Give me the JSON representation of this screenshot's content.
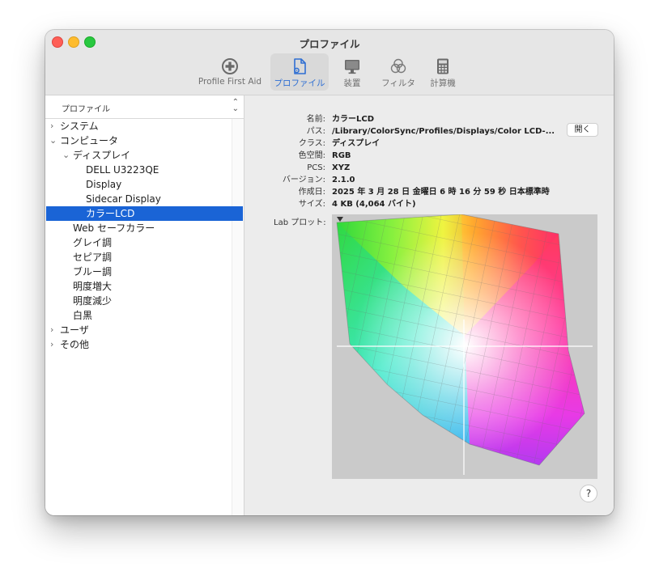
{
  "window": {
    "title": "プロファイル"
  },
  "toolbar": {
    "items": [
      {
        "label": "Profile First Aid",
        "icon": "first-aid-icon"
      },
      {
        "label": "プロファイル",
        "icon": "profile-document-icon",
        "active": true
      },
      {
        "label": "装置",
        "icon": "display-icon"
      },
      {
        "label": "フィルタ",
        "icon": "filter-icon"
      },
      {
        "label": "計算機",
        "icon": "calculator-icon"
      }
    ]
  },
  "sidebar": {
    "header": "プロファイル",
    "tree": [
      {
        "label": "システム",
        "expanded": false
      },
      {
        "label": "コンピュータ",
        "expanded": true
      },
      {
        "label": "ディスプレイ",
        "expanded": true
      },
      {
        "label": "DELL U3223QE"
      },
      {
        "label": "Display"
      },
      {
        "label": "Sidecar Display"
      },
      {
        "label": "カラーLCD",
        "selected": true
      },
      {
        "label": "Web セーフカラー"
      },
      {
        "label": "グレイ調"
      },
      {
        "label": "セピア調"
      },
      {
        "label": "ブルー調"
      },
      {
        "label": "明度増大"
      },
      {
        "label": "明度減少"
      },
      {
        "label": "白黒"
      },
      {
        "label": "ユーザ",
        "expanded": false
      },
      {
        "label": "その他",
        "expanded": false
      }
    ]
  },
  "details": {
    "name": {
      "label": "名前:",
      "value": "カラーLCD"
    },
    "path": {
      "label": "パス:",
      "value": "/Library/ColorSync/Profiles/Displays/Color LCD-..."
    },
    "class": {
      "label": "クラス:",
      "value": "ディスプレイ"
    },
    "color_space": {
      "label": "色空間:",
      "value": "RGB"
    },
    "pcs": {
      "label": "PCS:",
      "value": "XYZ"
    },
    "version": {
      "label": "バージョン:",
      "value": "2.1.0"
    },
    "created": {
      "label": "作成日:",
      "value": "2025 年 3 月 28 日 金曜日 6 時 16 分 59 秒 日本標準時"
    },
    "size": {
      "label": "サイズ:",
      "value": "4 KB (4,064 バイト)"
    },
    "open_button": "開く",
    "plot_label": "Lab プロット:",
    "help": "?"
  },
  "colors": {
    "selection": "#1a64d6",
    "accent": "#2f6fd3",
    "plot_bg": "#cacaca"
  }
}
